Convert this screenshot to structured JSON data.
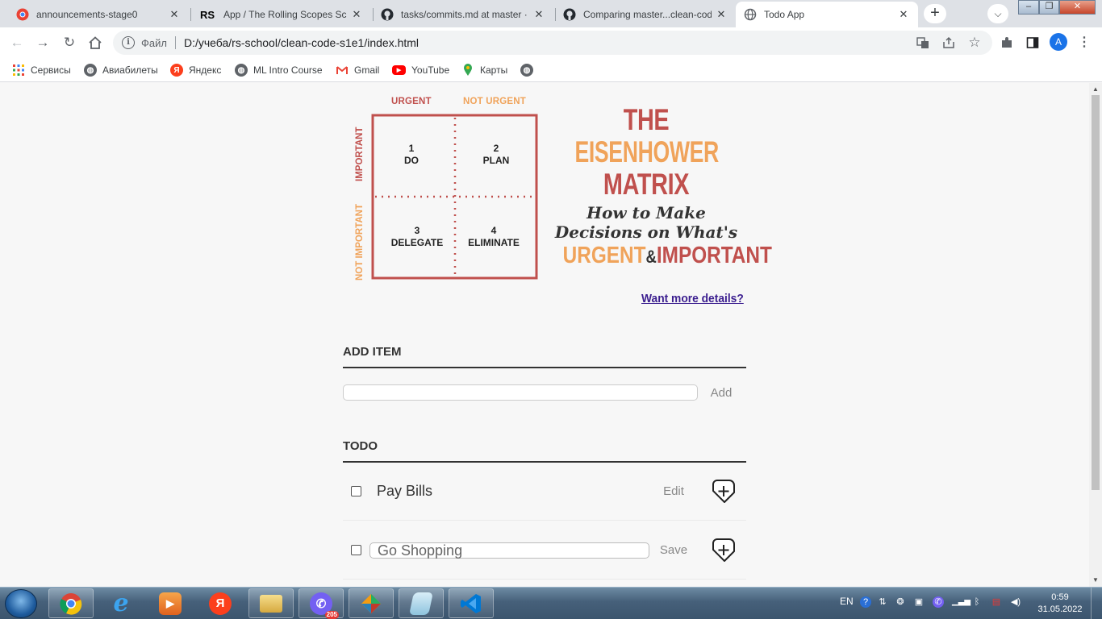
{
  "browser": {
    "tabs": [
      {
        "title": "announcements-stage0",
        "icon": "chrome-app-icon",
        "close": "✕"
      },
      {
        "title": "App / The Rolling Scopes School",
        "icon": "rs-logo-icon",
        "close": "✕"
      },
      {
        "title": "tasks/commits.md at master · r",
        "icon": "github-icon",
        "close": "✕"
      },
      {
        "title": "Comparing master...clean-code",
        "icon": "github-icon",
        "close": "✕"
      },
      {
        "title": "Todo App",
        "icon": "globe-icon",
        "close": "✕"
      }
    ],
    "new_tab": "+",
    "address": {
      "scheme": "Файл",
      "url": "D:/учеба/rs-school/clean-code-s1e1/index.html"
    },
    "avatar_letter": "A",
    "bookmarks": [
      {
        "label": "Сервисы",
        "icon": "apps-grid-icon"
      },
      {
        "label": "Авиабилеты",
        "icon": "globe-icon"
      },
      {
        "label": "Яндекс",
        "icon": "yandex-icon"
      },
      {
        "label": "ML Intro Course",
        "icon": "globe-icon"
      },
      {
        "label": "Gmail",
        "icon": "gmail-icon"
      },
      {
        "label": "YouTube",
        "icon": "youtube-icon"
      },
      {
        "label": "Карты",
        "icon": "maps-pin-icon"
      }
    ]
  },
  "matrix": {
    "col_headers": [
      "URGENT",
      "NOT URGENT"
    ],
    "row_headers": [
      "IMPORTANT",
      "NOT IMPORTANT"
    ],
    "cells": [
      {
        "num": "1",
        "label": "DO"
      },
      {
        "num": "2",
        "label": "PLAN"
      },
      {
        "num": "3",
        "label": "DELEGATE"
      },
      {
        "num": "4",
        "label": "ELIMINATE"
      }
    ],
    "colors": {
      "urgent": "#c0504d",
      "not_urgent": "#f0a35a",
      "grid": "#c0504d"
    }
  },
  "poster": {
    "line1": "THE",
    "line2": "EISENHOWER",
    "line3": "MATRIX",
    "script1": "How to Make",
    "script2": "Decisions on What's",
    "urgent": "URGENT",
    "amp": "&",
    "important": "IMPORTANT"
  },
  "details_link": "Want more details?",
  "add_section": {
    "title": "ADD ITEM",
    "button": "Add",
    "input_value": ""
  },
  "todo_section": {
    "title": "TODO",
    "items": [
      {
        "text": "Pay Bills",
        "action": "Edit",
        "editing": false,
        "checked": false
      },
      {
        "text": "Go Shopping",
        "action": "Save",
        "editing": true,
        "checked": false
      }
    ]
  },
  "taskbar": {
    "lang": "EN",
    "time": "0:59",
    "date": "31.05.2022",
    "viber_badge": "205",
    "apps": [
      "chrome-icon",
      "internet-explorer-icon",
      "media-player-icon",
      "yandex-browser-icon",
      "file-explorer-icon",
      "viber-icon",
      "colorful-app-icon",
      "notepad-icon",
      "vscode-icon"
    ]
  }
}
